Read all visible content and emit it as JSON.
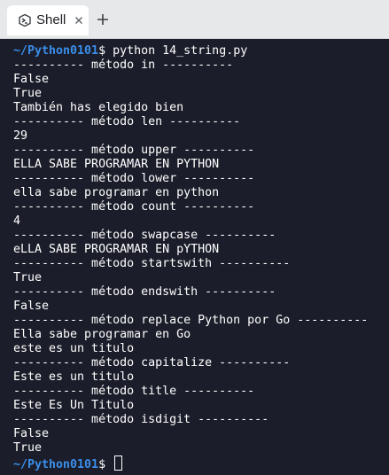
{
  "tab": {
    "title": "Shell",
    "icon": "shell-icon"
  },
  "terminal": {
    "prompt_path": "~/Python0101",
    "prompt_sign": "$",
    "command": "python 14_string.py",
    "output": [
      "---------- método in ----------",
      "False",
      "True",
      "También has elegido bien",
      "---------- método len ----------",
      "29",
      "---------- método upper ----------",
      "ELLA SABE PROGRAMAR EN PYTHON",
      "---------- método lower ----------",
      "ella sabe programar en python",
      "---------- método count ----------",
      "4",
      "---------- método swapcase ----------",
      "eLLA SABE PROGRAMAR EN pYTHON",
      "---------- método startswith ----------",
      "True",
      "---------- método endswith ----------",
      "False",
      "---------- método replace Python por Go ----------",
      "Ella sabe programar en Go",
      "este es un titulo",
      "---------- método capitalize ----------",
      "Este es un titulo",
      "---------- método title ----------",
      "Este Es Un Titulo",
      "---------- método isdigit ----------",
      "False",
      "True"
    ]
  },
  "colors": {
    "background": "#1b1e2a",
    "prompt_path": "#3b8eea",
    "text": "#ffffff"
  }
}
